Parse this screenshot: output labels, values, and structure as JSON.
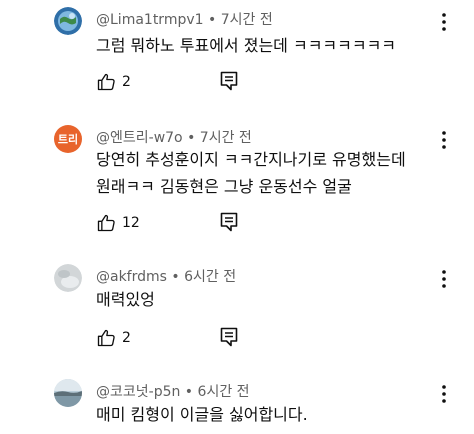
{
  "comments": [
    {
      "author": "@Lima1trmpv1",
      "separator": " • ",
      "time": "7시간 전",
      "lines": [
        "그럼 뭐하노 투표에서 졌는데 ㅋㅋㅋㅋㅋㅋㅋ"
      ],
      "likes": "2",
      "avatar_icon": "globe-photo-avatar"
    },
    {
      "author": "@엔트리-w7o",
      "separator": " • ",
      "time": "7시간 전",
      "lines": [
        "당연히 추성훈이지 ㅋㅋ간지나기로 유명했는데",
        "원래ㅋㅋ 김동현은 그냥  운동선수 얼굴"
      ],
      "likes": "12",
      "avatar_text": "트리",
      "avatar_color": "#e8642c"
    },
    {
      "author": "@akfrdms",
      "separator": " • ",
      "time": "6시간 전",
      "lines": [
        "매력있엉"
      ],
      "likes": "2",
      "avatar_icon": "grey-photo-avatar"
    },
    {
      "author": "@코코넛-p5n",
      "separator": " • ",
      "time": "6시간 전",
      "lines": [
        "매미 킴형이 이글을 싫어합니다."
      ],
      "avatar_icon": "landscape-photo-avatar"
    }
  ],
  "icons": {
    "like": "thumbs-up-icon",
    "reply": "reply-comment-icon",
    "menu": "more-vert-icon"
  }
}
